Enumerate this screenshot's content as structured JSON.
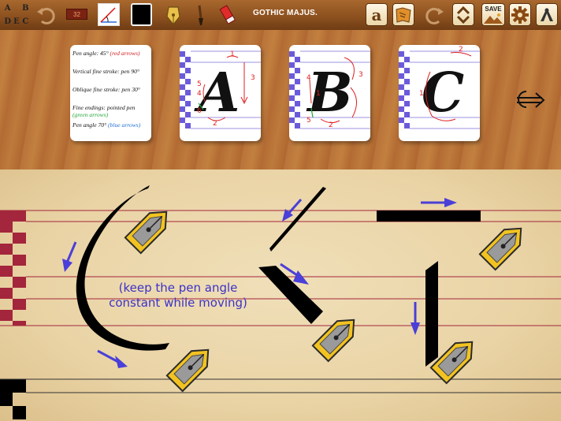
{
  "toolbar": {
    "letters_grid": [
      "A",
      "B",
      "C",
      "D",
      "E"
    ],
    "counter_value": "32",
    "title": "GOTHIC MAJUS.",
    "save_label": "SAVE",
    "current_color": "#000000",
    "icons": [
      "undo-icon",
      "pen-angle-icon",
      "nib-icon",
      "brush-icon",
      "eraser-icon",
      "alphabet-icon",
      "book-icon",
      "redo-icon",
      "up-down-icon",
      "save-icon",
      "gear-icon",
      "profile-icon"
    ]
  },
  "notes": {
    "pen_angle": "Pen angle: 45°",
    "pen_angle_note": "(red arrows)",
    "vertical": "Vertical fine stroke: pen 90°",
    "oblique": "Oblique fine stroke: pen 30°",
    "fine_endings": "Fine endings: pointed pen",
    "fine_endings_note": "(green arrows)",
    "pen_angle_2": "Pen angle 70°",
    "pen_angle_2_note": "(blue arrows)"
  },
  "cards": [
    {
      "letter": "A",
      "numbers": [
        "1",
        "2",
        "3",
        "4",
        "5",
        "6"
      ]
    },
    {
      "letter": "B",
      "numbers": [
        "1",
        "2",
        "3",
        "4",
        "5"
      ]
    },
    {
      "letter": "C",
      "numbers": [
        "1",
        "2"
      ]
    }
  ],
  "practice": {
    "hint": "(keep the pen angle constant while moving)",
    "arrow_color": "#4a3fd8",
    "line_color": "#a3263c"
  }
}
